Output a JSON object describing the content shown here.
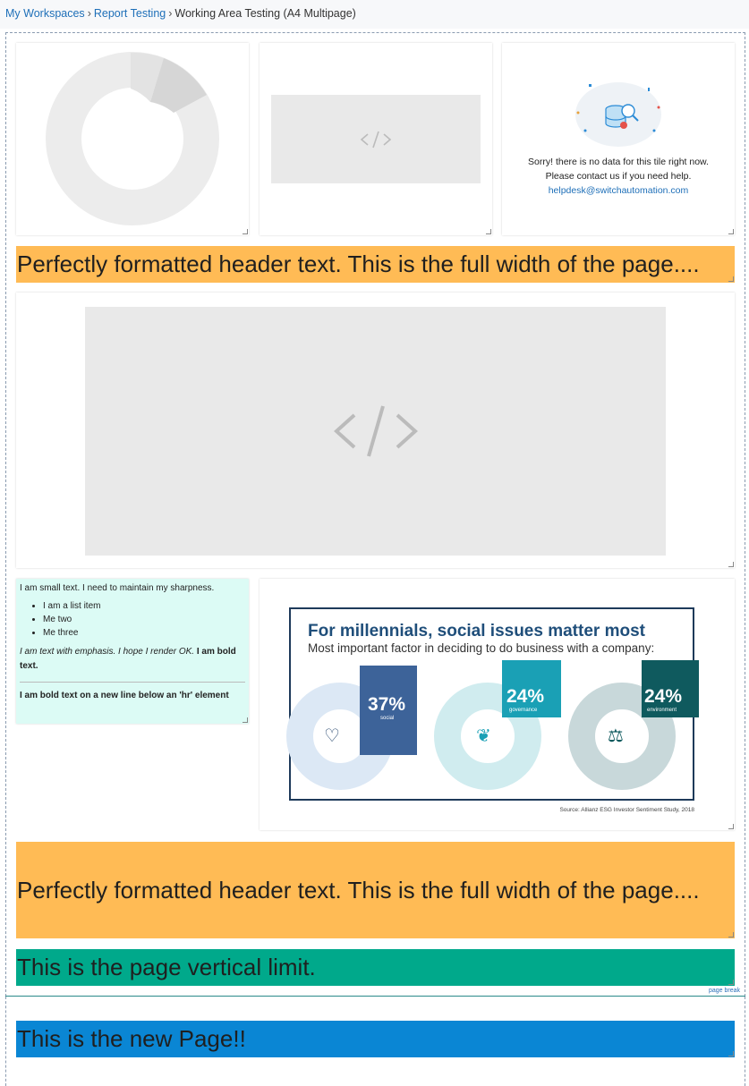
{
  "breadcrumb": {
    "item1": "My Workspaces",
    "item2": "Report Testing",
    "current": "Working Area Testing (A4 Multipage)",
    "separator": "›"
  },
  "nodata_tile": {
    "line1": "Sorry! there is no data for this tile right now.",
    "line2": "Please contact us if you need help.",
    "email": "helpdesk@switchautomation.com"
  },
  "header1": {
    "text": "Perfectly formatted header text. This is the full width of the page....",
    "color": "#ffbb55"
  },
  "richtext": {
    "small_text": "I am small text. I need to maintain my sharpness.",
    "list": [
      "I am a list item",
      "Me two",
      "Me three"
    ],
    "emphasis": "I am text with emphasis. I hope I render OK.",
    "bold_inline": "I am bold text.",
    "bold_after_hr": "I am bold text on a new line below an 'hr' element"
  },
  "infographic": {
    "title": "For millennials, social issues matter most",
    "subtitle": "Most important factor in deciding to do business with a company:",
    "items": [
      {
        "value": "37%",
        "label": "social",
        "color": "#3d6399"
      },
      {
        "value": "24%",
        "label": "governance",
        "color": "#1aa0b5"
      },
      {
        "value": "24%",
        "label": "environment",
        "color": "#0f5a5e"
      }
    ],
    "source": "Source: Allianz ESG Investor Sentiment Study, 2018"
  },
  "header2": {
    "text": "Perfectly formatted header text. This is the full width of the page....",
    "color": "#ffbb55"
  },
  "vertical_limit": {
    "text": "This is the page vertical limit.",
    "color": "#00a98b"
  },
  "page_break": {
    "label": "page break"
  },
  "new_page": {
    "text": "This is the new Page!!",
    "color": "#0a86d4"
  }
}
